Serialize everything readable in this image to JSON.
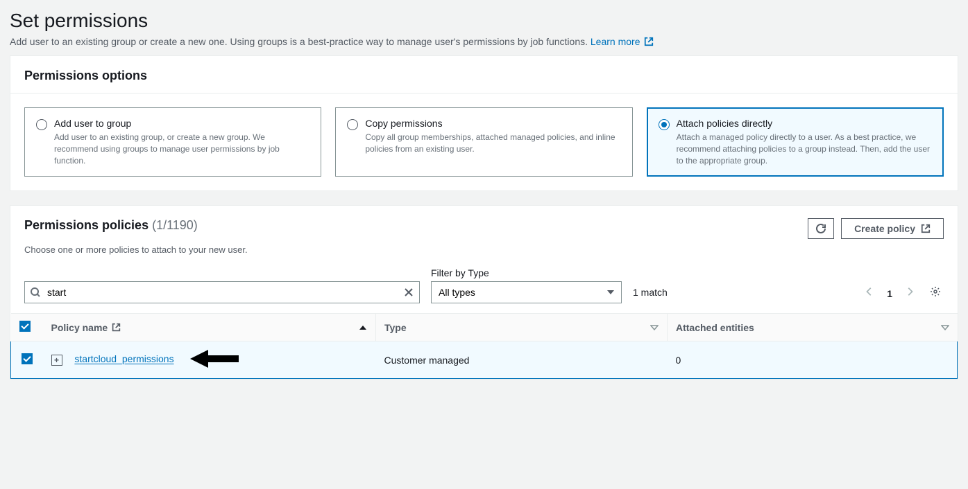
{
  "header": {
    "title": "Set permissions",
    "description": "Add user to an existing group or create a new one. Using groups is a best-practice way to manage user's permissions by job functions.",
    "learn_more": "Learn more"
  },
  "permissions_options": {
    "title": "Permissions options",
    "cards": [
      {
        "title": "Add user to group",
        "desc": "Add user to an existing group, or create a new group. We recommend using groups to manage user permissions by job function.",
        "selected": false
      },
      {
        "title": "Copy permissions",
        "desc": "Copy all group memberships, attached managed policies, and inline policies from an existing user.",
        "selected": false
      },
      {
        "title": "Attach policies directly",
        "desc": "Attach a managed policy directly to a user. As a best practice, we recommend attaching policies to a group instead. Then, add the user to the appropriate group.",
        "selected": true
      }
    ]
  },
  "policies_panel": {
    "title": "Permissions policies",
    "count": "(1/1190)",
    "subtitle": "Choose one or more policies to attach to your new user.",
    "create_button": "Create policy",
    "filter_label": "Filter by Type",
    "search_value": "start",
    "type_select": "All types",
    "match_text": "1 match",
    "page": "1",
    "columns": {
      "name": "Policy name",
      "type": "Type",
      "attached": "Attached entities"
    },
    "rows": [
      {
        "name": "startcloud_permissions",
        "type": "Customer managed",
        "attached": "0",
        "checked": true
      }
    ]
  }
}
